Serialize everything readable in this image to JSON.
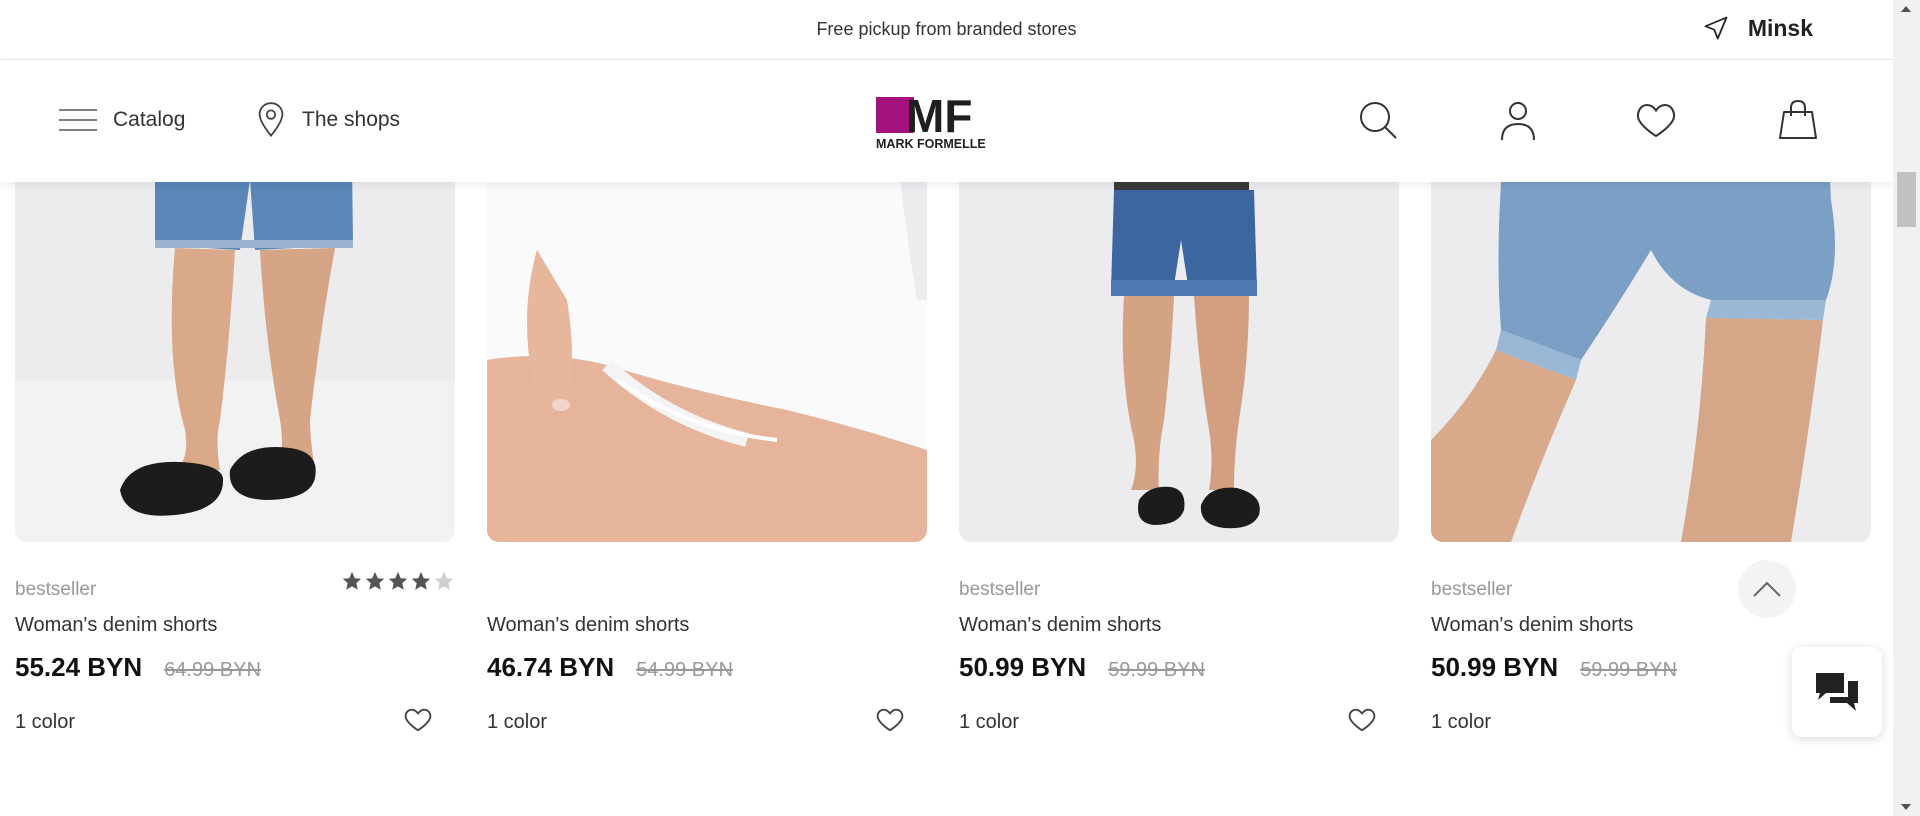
{
  "topbar": {
    "promo": "Free pickup from branded stores",
    "city": "Minsk"
  },
  "header": {
    "catalog_label": "Catalog",
    "shops_label": "The shops",
    "logo_text": "MF",
    "logo_subtext": "MARK FORMELLE",
    "brand_color": "#a3117c"
  },
  "products": [
    {
      "badge": "bestseller",
      "name": "Woman's denim shorts",
      "price": "55.24 BYN",
      "old_price": "64.99 BYN",
      "colors": "1 color",
      "rating": 4
    },
    {
      "badge": "",
      "name": "Woman's denim shorts",
      "price": "46.74 BYN",
      "old_price": "54.99 BYN",
      "colors": "1 color"
    },
    {
      "badge": "bestseller",
      "name": "Woman's denim shorts",
      "price": "50.99 BYN",
      "old_price": "59.99 BYN",
      "colors": "1 color"
    },
    {
      "badge": "bestseller",
      "name": "Woman's denim shorts",
      "price": "50.99 BYN",
      "old_price": "59.99 BYN",
      "colors": "1 color"
    }
  ],
  "icons": {
    "menu": "hamburger-icon",
    "location": "map-pin-icon",
    "city": "navigation-arrow-icon",
    "search": "search-icon",
    "account": "user-icon",
    "wishlist": "heart-icon",
    "cart": "shopping-bag-icon",
    "scroll_up": "chevron-up-icon",
    "chat": "chat-bubbles-icon"
  }
}
